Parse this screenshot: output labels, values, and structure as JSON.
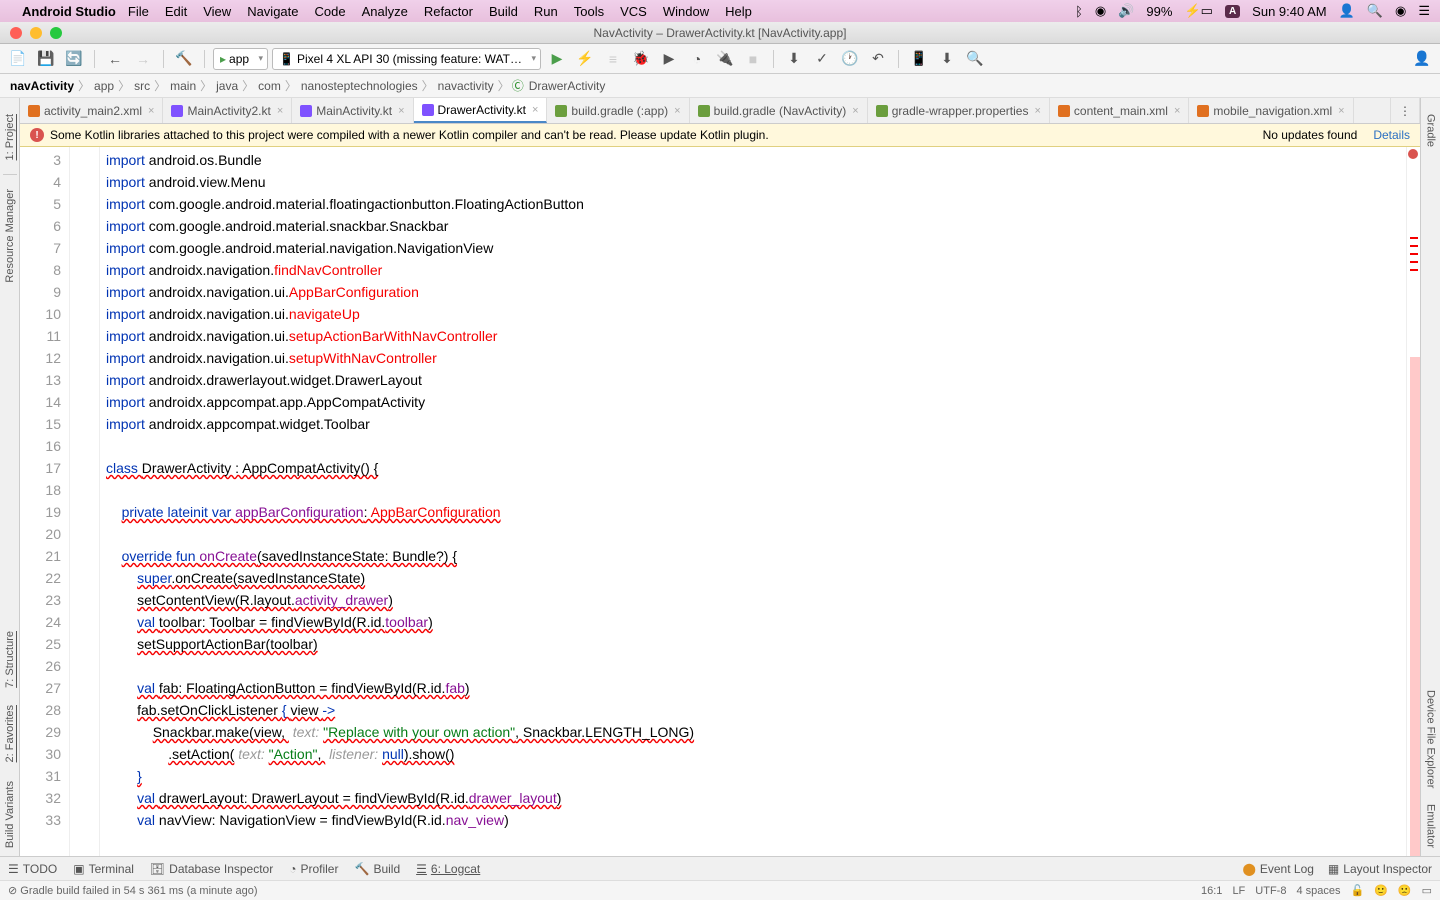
{
  "menubar": {
    "app": "Android Studio",
    "items": [
      "File",
      "Edit",
      "View",
      "Navigate",
      "Code",
      "Analyze",
      "Refactor",
      "Build",
      "Run",
      "Tools",
      "VCS",
      "Window",
      "Help"
    ],
    "battery": "99%",
    "clock": "Sun 9:40 AM"
  },
  "window": {
    "title": "NavActivity – DrawerActivity.kt [NavActivity.app]"
  },
  "toolbar": {
    "config": "app",
    "device": "Pixel 4 XL API 30 (missing feature: WAT…"
  },
  "breadcrumb": [
    "navActivity",
    "app",
    "src",
    "main",
    "java",
    "com",
    "nanosteptechnologies",
    "navactivity",
    "DrawerActivity"
  ],
  "tabs": [
    {
      "label": "activity_main2.xml"
    },
    {
      "label": "MainActivity2.kt"
    },
    {
      "label": "MainActivity.kt"
    },
    {
      "label": "DrawerActivity.kt",
      "active": true
    },
    {
      "label": "build.gradle (:app)"
    },
    {
      "label": "build.gradle (NavActivity)"
    },
    {
      "label": "gradle-wrapper.properties"
    },
    {
      "label": "content_main.xml"
    },
    {
      "label": "mobile_navigation.xml"
    }
  ],
  "banner": {
    "msg": "Some Kotlin libraries attached to this project were compiled with a newer Kotlin compiler and can't be read. Please update Kotlin plugin.",
    "noupdates": "No updates found",
    "details": "Details"
  },
  "code": {
    "start": 3,
    "lines": [
      [
        {
          "t": "import ",
          "c": "kw"
        },
        {
          "t": "android.os.Bundle"
        }
      ],
      [
        {
          "t": "import ",
          "c": "kw"
        },
        {
          "t": "android.view.Menu"
        }
      ],
      [
        {
          "t": "import ",
          "c": "kw"
        },
        {
          "t": "com.google.android.material.floatingactionbutton.FloatingActionButton"
        }
      ],
      [
        {
          "t": "import ",
          "c": "kw"
        },
        {
          "t": "com.google.android.material.snackbar.Snackbar"
        }
      ],
      [
        {
          "t": "import ",
          "c": "kw"
        },
        {
          "t": "com.google.android.material.navigation.NavigationView"
        }
      ],
      [
        {
          "t": "import ",
          "c": "kw"
        },
        {
          "t": "androidx.navigation."
        },
        {
          "t": "findNavController",
          "c": "err"
        }
      ],
      [
        {
          "t": "import ",
          "c": "kw"
        },
        {
          "t": "androidx.navigation.ui."
        },
        {
          "t": "AppBarConfiguration",
          "c": "err"
        }
      ],
      [
        {
          "t": "import ",
          "c": "kw"
        },
        {
          "t": "androidx.navigation.ui."
        },
        {
          "t": "navigateUp",
          "c": "err"
        }
      ],
      [
        {
          "t": "import ",
          "c": "kw"
        },
        {
          "t": "androidx.navigation.ui."
        },
        {
          "t": "setupActionBarWithNavController",
          "c": "err"
        }
      ],
      [
        {
          "t": "import ",
          "c": "kw"
        },
        {
          "t": "androidx.navigation.ui."
        },
        {
          "t": "setupWithNavController",
          "c": "err"
        }
      ],
      [
        {
          "t": "import ",
          "c": "kw"
        },
        {
          "t": "androidx.drawerlayout.widget.DrawerLayout"
        }
      ],
      [
        {
          "t": "import ",
          "c": "kw"
        },
        {
          "t": "androidx.appcompat.app.AppCompatActivity"
        }
      ],
      [
        {
          "t": "import ",
          "c": "kw"
        },
        {
          "t": "androidx.appcompat.widget.Toolbar"
        }
      ],
      [
        {
          "t": ""
        }
      ],
      [
        {
          "t": "class ",
          "c": "kw wavy"
        },
        {
          "t": "DrawerActivity : AppCompatActivity() {",
          "c": "wavy"
        }
      ],
      [
        {
          "t": ""
        }
      ],
      [
        {
          "t": "    "
        },
        {
          "t": "private lateinit var ",
          "c": "kw wavy"
        },
        {
          "t": "appBarConfiguration",
          "c": "fn wavy"
        },
        {
          "t": ": ",
          "c": "wavy"
        },
        {
          "t": "AppBarConfiguration",
          "c": "err wavy"
        }
      ],
      [
        {
          "t": ""
        }
      ],
      [
        {
          "t": "    "
        },
        {
          "t": "override fun ",
          "c": "kw wavy"
        },
        {
          "t": "onCreate",
          "c": "fn wavy"
        },
        {
          "t": "(savedInstanceState: Bundle?) {",
          "c": "wavy"
        }
      ],
      [
        {
          "t": "        "
        },
        {
          "t": "super",
          "c": "kw wavy"
        },
        {
          "t": ".onCreate(savedInstanceState)",
          "c": "wavy"
        }
      ],
      [
        {
          "t": "        "
        },
        {
          "t": "setContentView(R.layout.",
          "c": "wavy"
        },
        {
          "t": "activity_drawer",
          "c": "fn wavy"
        },
        {
          "t": ")",
          "c": "wavy"
        }
      ],
      [
        {
          "t": "        "
        },
        {
          "t": "val ",
          "c": "kw wavy"
        },
        {
          "t": "toolbar: Toolbar = findViewById(R.id.",
          "c": "wavy"
        },
        {
          "t": "toolbar",
          "c": "fn wavy"
        },
        {
          "t": ")",
          "c": "wavy"
        }
      ],
      [
        {
          "t": "        "
        },
        {
          "t": "setSupportActionBar(toolbar)",
          "c": "wavy"
        }
      ],
      [
        {
          "t": ""
        }
      ],
      [
        {
          "t": "        "
        },
        {
          "t": "val ",
          "c": "kw wavy"
        },
        {
          "t": "fab: FloatingActionButton = findViewById(R.id.",
          "c": "wavy"
        },
        {
          "t": "fab",
          "c": "fn wavy"
        },
        {
          "t": ")",
          "c": "wavy"
        }
      ],
      [
        {
          "t": "        "
        },
        {
          "t": "fab.setOnClickListener ",
          "c": "wavy"
        },
        {
          "t": "{ ",
          "c": "kw wavy"
        },
        {
          "t": "view ",
          "c": "wavy"
        },
        {
          "t": "->",
          "c": "kw wavy"
        }
      ],
      [
        {
          "t": "            "
        },
        {
          "t": "Snackbar.make(view, ",
          "c": "wavy"
        },
        {
          "t": " text: ",
          "c": "hint"
        },
        {
          "t": "\"Replace with your own action\"",
          "c": "str wavy"
        },
        {
          "t": ", Snackbar.LENGTH_LONG)",
          "c": "wavy"
        }
      ],
      [
        {
          "t": "                "
        },
        {
          "t": ".setAction(",
          "c": "wavy"
        },
        {
          "t": " text: ",
          "c": "hint"
        },
        {
          "t": "\"Action\"",
          "c": "str wavy"
        },
        {
          "t": ", ",
          "c": "wavy"
        },
        {
          "t": " listener: ",
          "c": "hint"
        },
        {
          "t": "null",
          "c": "kw wavy"
        },
        {
          "t": ").show()",
          "c": "wavy"
        }
      ],
      [
        {
          "t": "        "
        },
        {
          "t": "}",
          "c": "kw wavy"
        }
      ],
      [
        {
          "t": "        "
        },
        {
          "t": "val ",
          "c": "kw wavy"
        },
        {
          "t": "drawerLayout: DrawerLayout = findViewById(R.id.",
          "c": "wavy"
        },
        {
          "t": "drawer_layout",
          "c": "fn wavy"
        },
        {
          "t": ")",
          "c": "wavy"
        }
      ],
      [
        {
          "t": "        "
        },
        {
          "t": "val ",
          "c": "kw"
        },
        {
          "t": "navView: NavigationView = findViewById(R.id."
        },
        {
          "t": "nav_view",
          "c": "fn"
        },
        {
          "t": ")"
        }
      ]
    ]
  },
  "left_tools": [
    "1: Project",
    "Resource Manager"
  ],
  "left_tools_bottom": [
    "7: Structure",
    "2: Favorites",
    "Build Variants"
  ],
  "right_tools": [
    "Gradle",
    "Device File Explorer",
    "Emulator"
  ],
  "bottom": {
    "items": [
      "TODO",
      "Terminal",
      "Database Inspector",
      "Profiler",
      "Build",
      "6: Logcat"
    ],
    "eventlog": "Event Log",
    "layoutinsp": "Layout Inspector"
  },
  "status": {
    "msg": "Gradle build failed in 54 s 361 ms (a minute ago)",
    "pos": "16:1",
    "le": "LF",
    "enc": "UTF-8",
    "indent": "4 spaces"
  }
}
